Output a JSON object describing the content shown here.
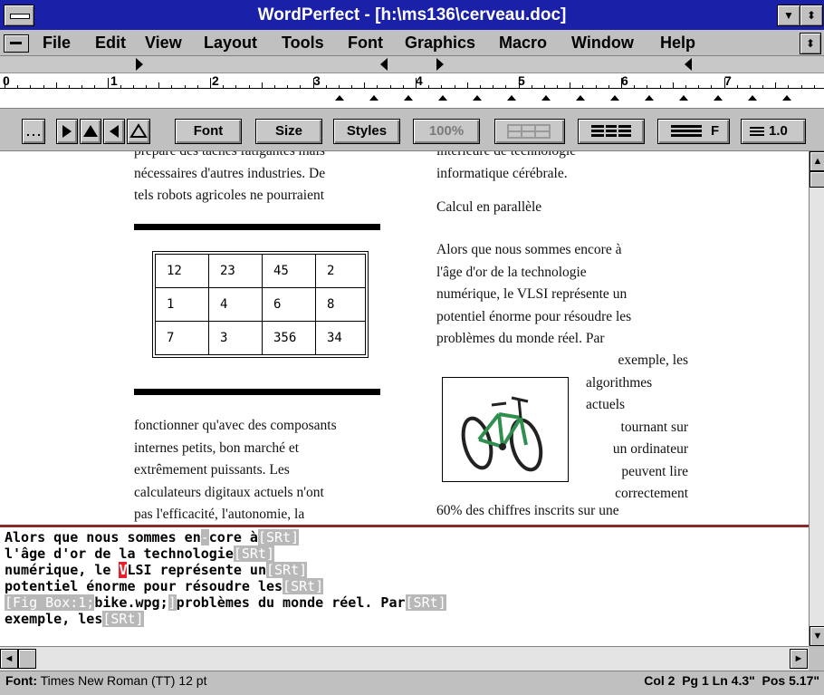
{
  "window": {
    "title": "WordPerfect - [h:\\ms136\\cerveau.doc]"
  },
  "title_buttons": {
    "minimize": "▼",
    "restore": "⬍"
  },
  "menu": [
    "File",
    "Edit",
    "View",
    "Layout",
    "Tools",
    "Font",
    "Graphics",
    "Macro",
    "Window",
    "Help"
  ],
  "menu_restore": "⬍",
  "ruler": {
    "numbers": [
      "0",
      "1",
      "2",
      "3",
      "4",
      "5",
      "6",
      "7"
    ]
  },
  "toolbar": {
    "font": "Font",
    "size": "Size",
    "styles": "Styles",
    "zoom": "100%",
    "columns_label": "F",
    "spacing": "1.0"
  },
  "document": {
    "left_top": [
      "prépare des tâches fatigantes mais",
      "nécessaires d'autres industries. De",
      "tels robots agricoles ne pourraient"
    ],
    "table": [
      [
        "12",
        "23",
        "45",
        "2"
      ],
      [
        "1",
        "4",
        "6",
        "8"
      ],
      [
        "7",
        "3",
        "356",
        "34"
      ]
    ],
    "left_bottom": [
      "fonctionner qu'avec des composants",
      "internes petits, bon marché et",
      "extrêmement puissants. Les",
      "calculateurs digitaux actuels n'ont",
      "pas l'efficacité, l'autonomie, la"
    ],
    "right_top": [
      "intérieure de technologie",
      "informatique cérébrale."
    ],
    "heading": "Calcul en parallèle",
    "right_para": [
      "Alors que nous sommes encore à",
      "l'âge d'or de la technologie",
      "numérique, le VLSI représente un",
      "potentiel énorme pour résoudre les",
      "problèmes du monde réel. Par"
    ],
    "wrap_lines": [
      "exemple, les",
      "algorithmes",
      "actuels",
      "tournant sur",
      "un ordinateur",
      "peuvent lire",
      "correctement"
    ],
    "right_last": "60% des chiffres inscrits sur une"
  },
  "reveal_codes": {
    "line1_text": "Alors que nous sommes en",
    "line1_b": "core à",
    "line2_text": "l'âge d'or de la technologie",
    "line3_a": "numérique, le ",
    "line3_cursor": "V",
    "line3_b": "LSI représente un",
    "line4_text": "potentiel énorme pour résoudre les",
    "line5_code": "[Fig Box:1;",
    "line5_file": "bike.wpg;",
    "line5_text": "problèmes du monde réel. Par",
    "line6_text": "exemple, les",
    "srt": "[SRt]",
    "hyph": "-",
    "fig_end": "]"
  },
  "scroll": {
    "up": "▲",
    "down": "▼",
    "left": "◄",
    "right": "►"
  },
  "status": {
    "font_label": "Font:",
    "font_value": "Times New Roman (TT) 12 pt",
    "position": "Col 2  Pg 1 Ln 4.3\"  Pos 5.17\""
  }
}
